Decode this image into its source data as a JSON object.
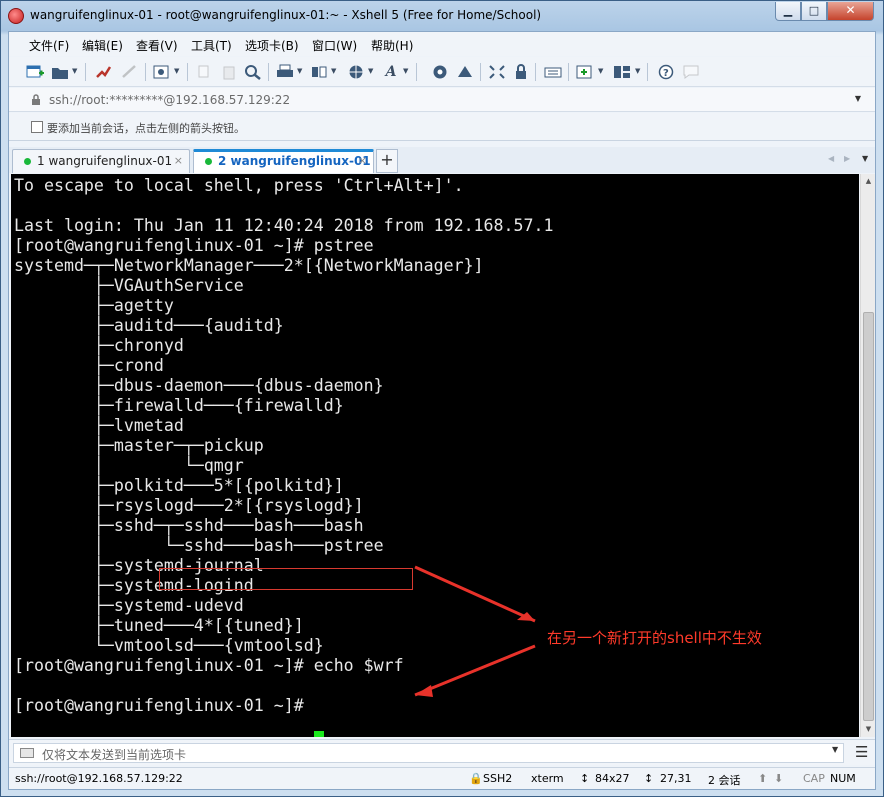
{
  "window": {
    "title": "wangruifenglinux-01 - root@wangruifenglinux-01:~ - Xshell 5 (Free for Home/School)",
    "controls": {
      "minimize": "▁",
      "maximize": "□",
      "close": "✕"
    }
  },
  "menu": [
    "文件(F)",
    "编辑(E)",
    "查看(V)",
    "工具(T)",
    "选项卡(B)",
    "窗口(W)",
    "帮助(H)"
  ],
  "address": {
    "text": "ssh://root:*********@192.168.57.129:22"
  },
  "hint": {
    "text": "要添加当前会话，点击左侧的箭头按钮。"
  },
  "tabs": [
    {
      "label": "1 wangruifenglinux-01",
      "close": "×",
      "active": false
    },
    {
      "label": "2 wangruifenglinux-01",
      "close": "×",
      "active": true
    }
  ],
  "new_tab": "+",
  "terminal": {
    "lines": [
      "To escape to local shell, press 'Ctrl+Alt+]'.",
      "",
      "Last login: Thu Jan 11 12:40:24 2018 from 192.168.57.1",
      "[root@wangruifenglinux-01 ~]# pstree",
      "systemd─┬─NetworkManager───2*[{NetworkManager}]",
      "        ├─VGAuthService",
      "        ├─agetty",
      "        ├─auditd───{auditd}",
      "        ├─chronyd",
      "        ├─crond",
      "        ├─dbus-daemon───{dbus-daemon}",
      "        ├─firewalld───{firewalld}",
      "        ├─lvmetad",
      "        ├─master─┬─pickup",
      "        │        └─qmgr",
      "        ├─polkitd───5*[{polkitd}]",
      "        ├─rsyslogd───2*[{rsyslogd}]",
      "        ├─sshd─┬─sshd───bash───bash",
      "        │      └─sshd───bash───pstree",
      "        ├─systemd-journal",
      "        ├─systemd-logind",
      "        ├─systemd-udevd",
      "        ├─tuned───4*[{tuned}]",
      "        └─vmtoolsd───{vmtoolsd}",
      "[root@wangruifenglinux-01 ~]# echo $wrf",
      "",
      "[root@wangruifenglinux-01 ~]# "
    ],
    "annotation": "在另一个新打开的shell中不生效",
    "colors": {
      "background": "#000000",
      "text": "#e8e8e8",
      "cursor": "#19e81d",
      "annotation": "#ff3a2a"
    }
  },
  "compose": {
    "placeholder": "仅将文本发送到当前选项卡"
  },
  "status": {
    "connection": "ssh://root@192.168.57.129:22",
    "protocol": "SSH2",
    "terminal": "xterm",
    "size": "84x27",
    "cursor_pos": "27,31",
    "sessions": "2 会话",
    "caps": "CAP",
    "num": "NUM"
  }
}
